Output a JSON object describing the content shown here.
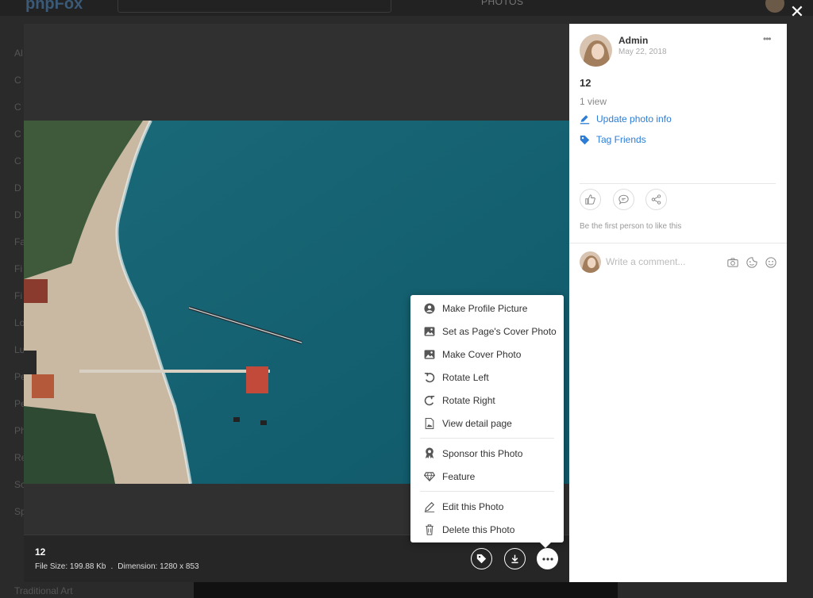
{
  "background": {
    "logo": "phpFox",
    "section_label": "PHOTOS",
    "sidebar_letters": [
      "Al",
      "C",
      "C",
      "C",
      "C",
      "D",
      "D",
      "Fa",
      "Fi",
      "Fi",
      "Lo",
      "Lu",
      "Pe",
      "Pe",
      "Ph",
      "Re",
      "Sc",
      "Sp"
    ],
    "bottom_text": "Traditional Art"
  },
  "close_label": "✕",
  "photo": {
    "title": "12",
    "file_size_label": "File Size: 199.88 Kb",
    "dimension_label": "Dimension: 1280 x 853",
    "separator": "."
  },
  "menu": {
    "items": [
      {
        "label": "Make Profile Picture",
        "icon": "user-circle-icon"
      },
      {
        "label": "Set as Page's Cover Photo",
        "icon": "image-icon"
      },
      {
        "label": "Make Cover Photo",
        "icon": "image-icon"
      },
      {
        "label": "Rotate Left",
        "icon": "rotate-left-icon"
      },
      {
        "label": "Rotate Right",
        "icon": "rotate-right-icon"
      },
      {
        "label": "View detail page",
        "icon": "file-image-icon"
      }
    ],
    "promo_items": [
      {
        "label": "Sponsor this Photo",
        "icon": "sponsor-badge-icon"
      },
      {
        "label": "Feature",
        "icon": "diamond-icon"
      }
    ],
    "edit_items": [
      {
        "label": "Edit this Photo",
        "icon": "pencil-icon"
      },
      {
        "label": "Delete this Photo",
        "icon": "trash-icon"
      }
    ]
  },
  "panel": {
    "author": "Admin",
    "date": "May 22, 2018",
    "more": "•••",
    "title": "12",
    "views": "1 view",
    "update_link": "Update photo info",
    "tag_link": "Tag Friends",
    "like_prompt": "Be the first person to like this",
    "comment_placeholder": "Write a comment..."
  },
  "colors": {
    "link": "#2d7dd6",
    "viewer_bg": "#303030",
    "sea": "#1f6b7a"
  }
}
